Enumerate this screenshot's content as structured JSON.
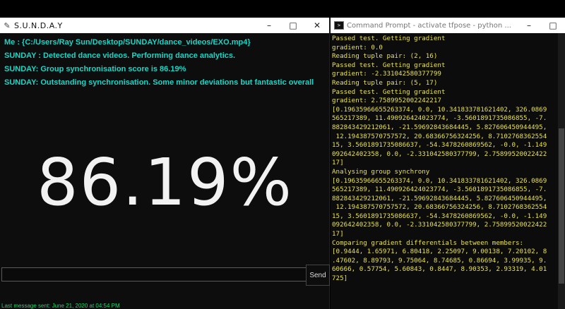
{
  "sunday": {
    "title": "S.U.N.D.A.Y",
    "icon": "quill-icon",
    "chat": [
      "Me : {C:/Users/Ray Sun/Desktop/SUNDAY/dance_videos/EXO.mp4}",
      "SUNDAY : Detected dance videos. Performing dance analytics.",
      "SUNDAY: Group synchronisation score is 86.19%",
      "SUNDAY: Outstanding synchronisation. Some minor deviations but fantastic overall"
    ],
    "score": "86.19%",
    "input_value": "",
    "send_label": "Send",
    "status": "Last message sent: June 21, 2020 at 04:54 PM"
  },
  "cmd": {
    "title": "Command Prompt - activate  tfpose - python ...",
    "lines": [
      "Passed test. Getting gradient",
      "gradient: 0.0",
      "Reading tuple pair: (2, 16)",
      "Passed test. Getting gradient",
      "gradient: -2.331042580377799",
      "Reading tuple pair: (5, 17)",
      "Passed test. Getting gradient",
      "gradient: 2.7589952002242217",
      "[0.19635966655263374, 0.0, 10.341833781621402, 326.0869",
      "565217389, 11.490926424023774, -3.5601891735086855, -7.",
      "882843429212061, -21.59692843684445, 5.827606450944495,",
      " 12.194387570757572, 20.68366756324256, 8.7102768362554",
      "15, 3.5601891735086637, -54.3478260869562, -0.0, -1.149",
      "092642402358, 0.0, -2.331042580377799, 2.75899520022422",
      "17]",
      "Analysing group synchrony",
      "[0.19635966655263374, 0.0, 10.341833781621402, 326.0869",
      "565217389, 11.490926424023774, -3.5601891735086855, -7.",
      "882843429212061, -21.59692843684445, 5.827606450944495,",
      " 12.194387570757572, 20.68366756324256, 8.7102768362554",
      "15, 3.5601891735086637, -54.3478260869562, -0.0, -1.149",
      "092642402358, 0.0, -2.331042580377799, 2.75899520022422",
      "17]",
      "Comparing gradient differentials between members:",
      "[0.9444, 1.65971, 6.80418, 2.25097, 9.00138, 7.20102, 8",
      ".47602, 8.89793, 9.75064, 8.74685, 0.86694, 3.99935, 9.",
      "60666, 0.57754, 5.60843, 0.8447, 8.90353, 2.93319, 4.01",
      "725]"
    ]
  },
  "colors": {
    "chat_text": "#19d6c6",
    "console_text": "#e9e24c",
    "status_text": "#19d66a"
  }
}
